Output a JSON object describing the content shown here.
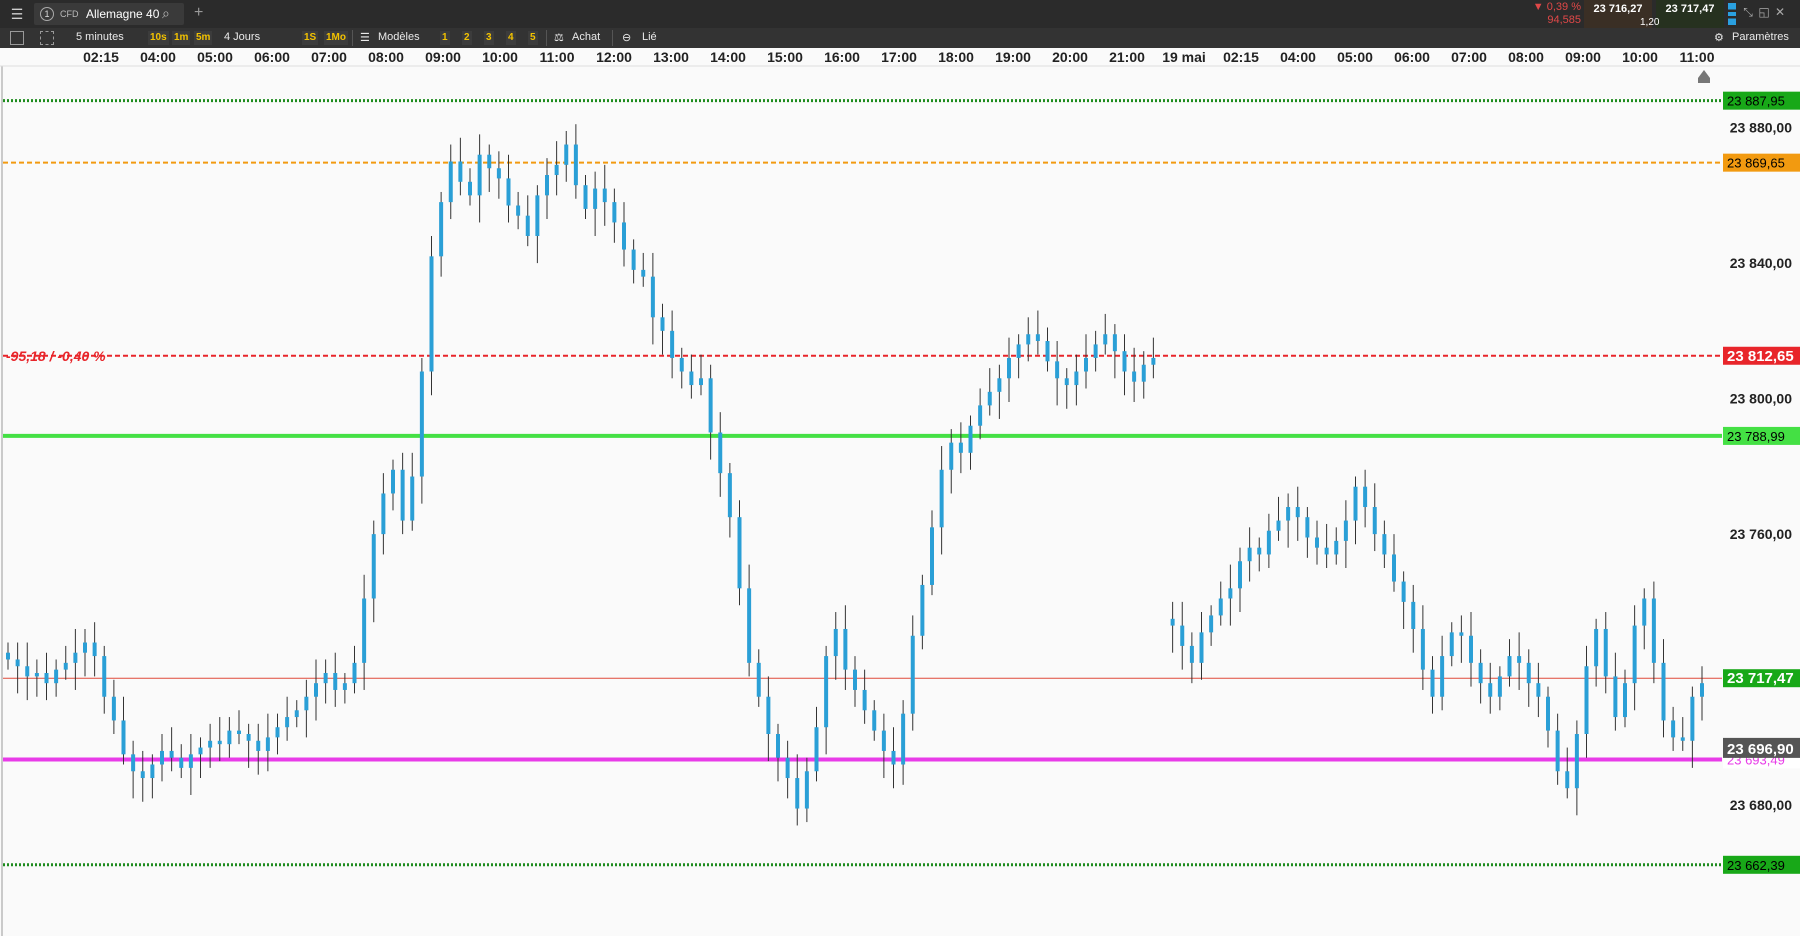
{
  "header": {
    "tab_number": "1",
    "instrument_type": "CFD",
    "instrument_name": "Allemagne 40",
    "change_pct": "▼ 0,39 %",
    "change_abs": "94,585",
    "bid": "23 716,27",
    "ask": "23 717,47",
    "spread": "1,20"
  },
  "toolbar": {
    "interval": "5 minutes",
    "quick_intervals": [
      "10s",
      "1m",
      "5m"
    ],
    "period": "4 Jours",
    "quick_periods": [
      "1S",
      "1Mo"
    ],
    "templates_label": "Modèles",
    "template_slots": [
      "1",
      "2",
      "3",
      "4",
      "5"
    ],
    "order_label": "Achat",
    "linked_label": "Lié",
    "settings_label": "Paramètres"
  },
  "colors": {
    "candle": "#2a9fd6",
    "wick": "#333333",
    "line_high": "#1e8c1e",
    "line_orange": "#f29a10",
    "line_red": "#e8252a",
    "line_green": "#44e044",
    "line_magenta": "#e83be8",
    "line_current": "#e04a3a"
  },
  "chart_data": {
    "type": "candlestick",
    "time_labels": [
      "02:15",
      "04:00",
      "05:00",
      "06:00",
      "07:00",
      "08:00",
      "09:00",
      "10:00",
      "11:00",
      "12:00",
      "13:00",
      "14:00",
      "15:00",
      "16:00",
      "17:00",
      "18:00",
      "19:00",
      "20:00",
      "21:00",
      "19 mai",
      "02:15",
      "04:00",
      "05:00",
      "06:00",
      "07:00",
      "08:00",
      "09:00",
      "10:00",
      "11:00"
    ],
    "y_ticks": [
      "23 880,00",
      "23 840,00",
      "23 800,00",
      "23 760,00",
      "23 680,00"
    ],
    "ylim": [
      23652,
      23897
    ],
    "lines": [
      {
        "value": 23887.95,
        "label": "23 887,95",
        "style": "dotted",
        "color": "#1e8c1e"
      },
      {
        "value": 23869.65,
        "label": "23 869,65",
        "style": "dashed",
        "color": "#f29a10"
      },
      {
        "value": 23812.65,
        "label": "23 812,65",
        "style": "dashed",
        "color": "#e8252a",
        "note": "-95,18 / -0,40 %"
      },
      {
        "value": 23788.99,
        "label": "23 788,99",
        "style": "solid",
        "color": "#44e044"
      },
      {
        "value": 23717.47,
        "label": "23 717,47",
        "style": "thin",
        "color": "#e04a3a"
      },
      {
        "value": 23693.49,
        "label": "23 693,49",
        "style": "solid",
        "color": "#e83be8"
      },
      {
        "value": 23662.39,
        "label": "23 662,39",
        "style": "dotted",
        "color": "#1e8c1e"
      }
    ],
    "marker": {
      "value": 23696.9,
      "label": "23 696,90"
    },
    "close_series": [
      23723,
      23721,
      23718,
      23719,
      23716,
      23720,
      23722,
      23725,
      23728,
      23724,
      23712,
      23705,
      23695,
      23690,
      23688,
      23692,
      23696,
      23694,
      23691,
      23695,
      23697,
      23699,
      23698,
      23702,
      23701,
      23699,
      23696,
      23700,
      23703,
      23706,
      23708,
      23712,
      23716,
      23719,
      23714,
      23716,
      23722,
      23741,
      23760,
      23772,
      23779,
      23764,
      23777,
      23808,
      23842,
      23858,
      23870,
      23864,
      23860,
      23872,
      23868,
      23865,
      23857,
      23854,
      23848,
      23860,
      23866,
      23869,
      23875,
      23863,
      23856,
      23862,
      23858,
      23852,
      23844,
      23838,
      23836,
      23824,
      23820,
      23812,
      23808,
      23804,
      23806,
      23790,
      23778,
      23765,
      23744,
      23722,
      23712,
      23701,
      23694,
      23688,
      23679,
      23690,
      23703,
      23724,
      23732,
      23720,
      23714,
      23708,
      23702,
      23696,
      23692,
      23707,
      23730,
      23745,
      23762,
      23779,
      23787,
      23784,
      23792,
      23798,
      23802,
      23806,
      23812,
      23816,
      23819,
      23817,
      23811,
      23806,
      23804,
      23808,
      23812,
      23816,
      23819,
      23814,
      23808,
      23805,
      23810,
      23812,
      null,
      23733,
      23727,
      23722,
      23731,
      23736,
      23741,
      23744,
      23752,
      23756,
      23754,
      23761,
      23764,
      23768,
      23765,
      23759,
      23756,
      23754,
      23758,
      23764,
      23774,
      23768,
      23760,
      23754,
      23746,
      23740,
      23732,
      23720,
      23712,
      23724,
      23731,
      23730,
      23722,
      23716,
      23712,
      23718,
      23724,
      23722,
      23716,
      23712,
      23702,
      23690,
      23685,
      23701,
      23721,
      23732,
      23718,
      23706,
      23716,
      23733,
      23741,
      23722,
      23705,
      23700,
      23699,
      23712,
      23716
    ]
  }
}
